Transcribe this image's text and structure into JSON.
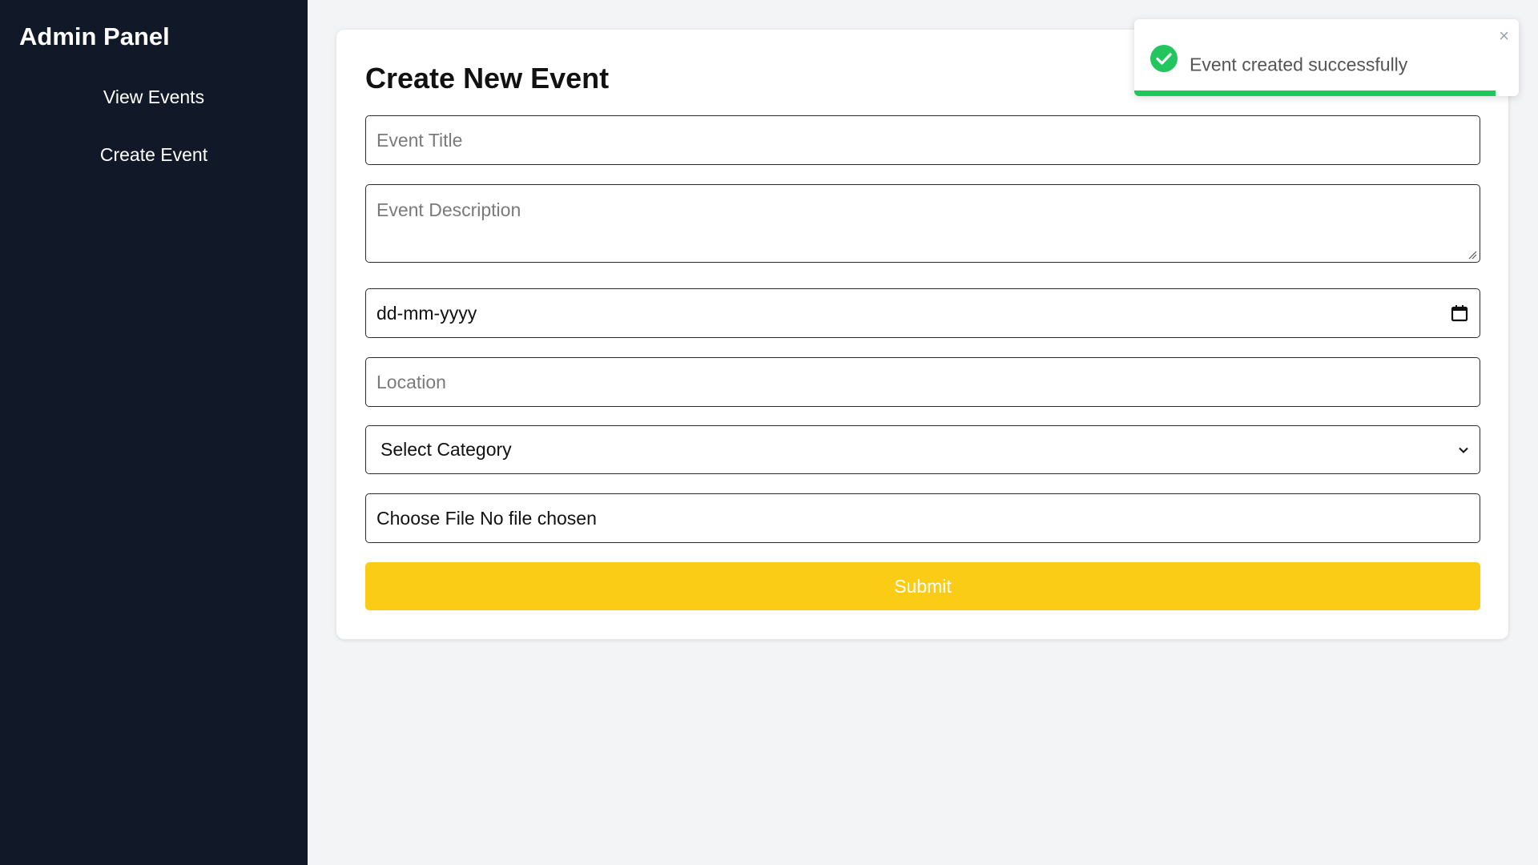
{
  "sidebar": {
    "title": "Admin Panel",
    "items": [
      {
        "label": "View Events"
      },
      {
        "label": "Create Event"
      }
    ]
  },
  "form": {
    "heading": "Create New Event",
    "title_placeholder": "Event Title",
    "description_placeholder": "Event Description",
    "date_value": "dd-mm-yyyy",
    "location_placeholder": "Location",
    "category_selected": "Select Category",
    "file_text": "Choose File No file chosen",
    "submit_label": "Submit"
  },
  "toast": {
    "message": "Event created successfully",
    "close_glyph": "×",
    "progress_fraction": 0.94
  },
  "colors": {
    "sidebar_bg": "#111827",
    "submit_bg": "#facc15",
    "success": "#22c55e"
  },
  "icons": {
    "date": "calendar-icon",
    "category": "chevron-down-icon",
    "toast": "check-circle-icon",
    "close": "close-icon"
  }
}
